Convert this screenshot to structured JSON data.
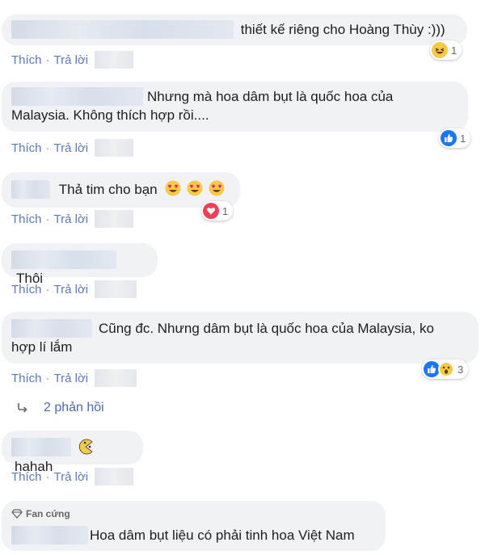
{
  "actions": {
    "like": "Thích",
    "dot": "·",
    "reply": "Trả lời"
  },
  "comments": [
    {
      "text": "thiết kế riêng cho Hoàng Thùy :)))",
      "reactions": {
        "count": "1",
        "icons": [
          "laugh-icon"
        ]
      }
    },
    {
      "text_line1": "Nhưng mà hoa dâm bụt là quốc hoa của",
      "text_line2": "Malaysia. Không thích hợp rồi....",
      "reactions": {
        "count": "1",
        "icons": [
          "like-icon"
        ]
      }
    },
    {
      "text": "Thả tim cho bạn",
      "emojis": [
        "heart-eyes-icon",
        "heart-eyes-icon",
        "heart-eyes-icon"
      ],
      "reactions": {
        "count": "1",
        "icons": [
          "love-icon"
        ]
      }
    },
    {
      "text": "Thôi"
    },
    {
      "text_line1": "Cũng đc. Nhưng dâm bụt là quốc hoa của Malaysia, ko",
      "text_line2": "hợp lí lắm",
      "reactions": {
        "count": "3",
        "icons": [
          "like-icon",
          "wow-icon"
        ]
      }
    },
    {
      "text": "hahah",
      "sticker": "pacman-sticker-icon"
    },
    {
      "badge": "Fan cứng",
      "text": "Hoa dâm bụt liệu có phải tinh hoa Việt Nam"
    }
  ],
  "replies": {
    "label": "2 phản hồi",
    "icon": "reply-arrow-icon"
  },
  "colors": {
    "bubble": "#f0f2f5",
    "link": "#5b7bb3",
    "like_blue": "#1877f2",
    "love_red": "#f33e58",
    "emoji_yellow": "#f7c948"
  }
}
